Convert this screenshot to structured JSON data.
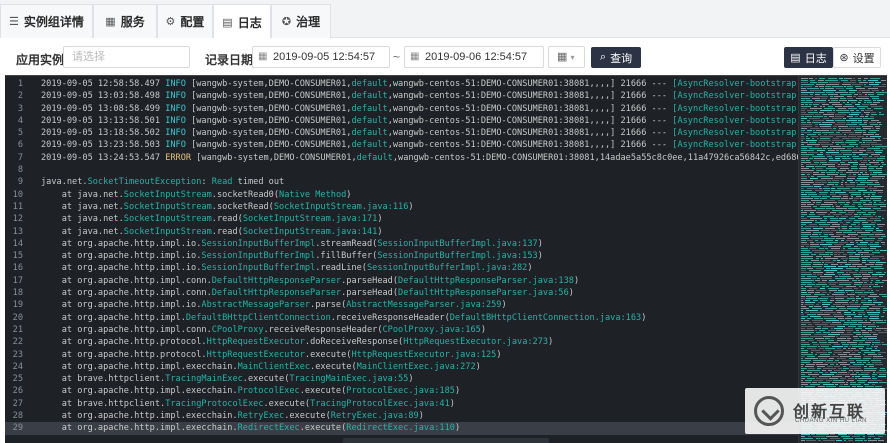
{
  "tabs": [
    {
      "label": "实例组详情",
      "icon": "list-icon",
      "glyph": "☰"
    },
    {
      "label": "服务",
      "icon": "grid-icon",
      "glyph": "▦"
    },
    {
      "label": "配置",
      "icon": "gear-icon",
      "glyph": "⚙"
    },
    {
      "label": "日志",
      "icon": "document-icon",
      "glyph": "▤"
    },
    {
      "label": "治理",
      "icon": "shield-icon",
      "glyph": "✪"
    }
  ],
  "active_tab": 3,
  "filter": {
    "app_label": "应用实例",
    "app_placeholder": "请选择",
    "date_label": "记录日期",
    "start": "2019-09-05 12:54:57",
    "end": "2019-09-06 12:54:57",
    "range_sep": "~",
    "query_label": "查询",
    "log_label": "日志",
    "settings_label": "设置"
  },
  "log_lines": [
    {
      "n": "1",
      "t": "2019-09-05 12:58:58.497",
      "lvl": "INFO",
      "msg": " [wangwb-system,DEMO-CONSUMER01,default,wangwb-centos-51:DEMO-CONSUMER01:38081,,,,] 21666 --- [AsyncResolver-bootstrap-"
    },
    {
      "n": "2",
      "t": "2019-09-05 13:03:58.498",
      "lvl": "INFO",
      "msg": " [wangwb-system,DEMO-CONSUMER01,default,wangwb-centos-51:DEMO-CONSUMER01:38081,,,,] 21666 --- [AsyncResolver-bootstrap-"
    },
    {
      "n": "3",
      "t": "2019-09-05 13:08:58.499",
      "lvl": "INFO",
      "msg": " [wangwb-system,DEMO-CONSUMER01,default,wangwb-centos-51:DEMO-CONSUMER01:38081,,,,] 21666 --- [AsyncResolver-bootstrap-"
    },
    {
      "n": "4",
      "t": "2019-09-05 13:13:58.501",
      "lvl": "INFO",
      "msg": " [wangwb-system,DEMO-CONSUMER01,default,wangwb-centos-51:DEMO-CONSUMER01:38081,,,,] 21666 --- [AsyncResolver-bootstrap-"
    },
    {
      "n": "5",
      "t": "2019-09-05 13:18:58.502",
      "lvl": "INFO",
      "msg": " [wangwb-system,DEMO-CONSUMER01,default,wangwb-centos-51:DEMO-CONSUMER01:38081,,,,] 21666 --- [AsyncResolver-bootstrap-"
    },
    {
      "n": "6",
      "t": "2019-09-05 13:23:58.503",
      "lvl": "INFO",
      "msg": " [wangwb-system,DEMO-CONSUMER01,default,wangwb-centos-51:DEMO-CONSUMER01:38081,,,,] 21666 --- [AsyncResolver-bootstrap-"
    },
    {
      "n": "7",
      "t": "2019-09-05 13:24:53.547",
      "lvl": "ERROR",
      "msg": " [wangwb-system,DEMO-CONSUMER01,default,wangwb-centos-51:DEMO-CONSUMER01:38081,14adae5a55c8c0ee,11a47926ca56842c,ed6867"
    },
    {
      "n": "8",
      "t": "",
      "lvl": "",
      "msg": ""
    },
    {
      "n": "9",
      "t": "",
      "lvl": "",
      "msg": "java.net.SocketTimeoutException: Read timed out"
    },
    {
      "n": "10",
      "t": "",
      "lvl": "",
      "msg": "    at java.net.SocketInputStream.socketRead0(Native Method)"
    },
    {
      "n": "11",
      "t": "",
      "lvl": "",
      "msg": "    at java.net.SocketInputStream.socketRead(SocketInputStream.java:116)"
    },
    {
      "n": "12",
      "t": "",
      "lvl": "",
      "msg": "    at java.net.SocketInputStream.read(SocketInputStream.java:171)"
    },
    {
      "n": "13",
      "t": "",
      "lvl": "",
      "msg": "    at java.net.SocketInputStream.read(SocketInputStream.java:141)"
    },
    {
      "n": "14",
      "t": "",
      "lvl": "",
      "msg": "    at org.apache.http.impl.io.SessionInputBufferImpl.streamRead(SessionInputBufferImpl.java:137)"
    },
    {
      "n": "15",
      "t": "",
      "lvl": "",
      "msg": "    at org.apache.http.impl.io.SessionInputBufferImpl.fillBuffer(SessionInputBufferImpl.java:153)"
    },
    {
      "n": "16",
      "t": "",
      "lvl": "",
      "msg": "    at org.apache.http.impl.io.SessionInputBufferImpl.readLine(SessionInputBufferImpl.java:282)"
    },
    {
      "n": "17",
      "t": "",
      "lvl": "",
      "msg": "    at org.apache.http.impl.conn.DefaultHttpResponseParser.parseHead(DefaultHttpResponseParser.java:138)"
    },
    {
      "n": "18",
      "t": "",
      "lvl": "",
      "msg": "    at org.apache.http.impl.conn.DefaultHttpResponseParser.parseHead(DefaultHttpResponseParser.java:56)"
    },
    {
      "n": "19",
      "t": "",
      "lvl": "",
      "msg": "    at org.apache.http.impl.io.AbstractMessageParser.parse(AbstractMessageParser.java:259)"
    },
    {
      "n": "20",
      "t": "",
      "lvl": "",
      "msg": "    at org.apache.http.impl.DefaultBHttpClientConnection.receiveResponseHeader(DefaultBHttpClientConnection.java:163)"
    },
    {
      "n": "21",
      "t": "",
      "lvl": "",
      "msg": "    at org.apache.http.impl.conn.CPoolProxy.receiveResponseHeader(CPoolProxy.java:165)"
    },
    {
      "n": "22",
      "t": "",
      "lvl": "",
      "msg": "    at org.apache.http.protocol.HttpRequestExecutor.doReceiveResponse(HttpRequestExecutor.java:273)"
    },
    {
      "n": "23",
      "t": "",
      "lvl": "",
      "msg": "    at org.apache.http.protocol.HttpRequestExecutor.execute(HttpRequestExecutor.java:125)"
    },
    {
      "n": "24",
      "t": "",
      "lvl": "",
      "msg": "    at org.apache.http.impl.execchain.MainClientExec.execute(MainClientExec.java:272)"
    },
    {
      "n": "25",
      "t": "",
      "lvl": "",
      "msg": "    at brave.httpclient.TracingMainExec.execute(TracingMainExec.java:55)"
    },
    {
      "n": "26",
      "t": "",
      "lvl": "",
      "msg": "    at org.apache.http.impl.execchain.ProtocolExec.execute(ProtocolExec.java:185)"
    },
    {
      "n": "27",
      "t": "",
      "lvl": "",
      "msg": "    at brave.httpclient.TracingProtocolExec.execute(TracingProtocolExec.java:41)"
    },
    {
      "n": "28",
      "t": "",
      "lvl": "",
      "msg": "    at org.apache.http.impl.execchain.RetryExec.execute(RetryExec.java:89)"
    },
    {
      "n": "29",
      "t": "",
      "lvl": "",
      "msg": "    at org.apache.http.impl.execchain.RedirectExec.execute(RedirectExec.java:110)"
    }
  ],
  "highlight_line": "29",
  "colors": {
    "info": "#3fc4cf",
    "error": "#e5c07b",
    "class": "#27b3a8",
    "bg": "#1e2227",
    "accent": "#2b3345"
  },
  "watermark": {
    "title": "创新互联",
    "subtitle": "CHUANG XIN HU LIAN"
  }
}
